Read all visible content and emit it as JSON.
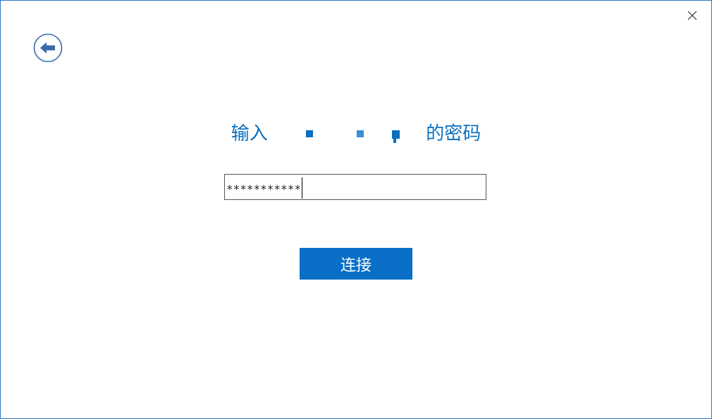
{
  "dialog": {
    "title_prefix": "输入",
    "title_suffix": "的密码",
    "password_value": "***********",
    "connect_label": "连接"
  },
  "icons": {
    "close": "close-icon",
    "back": "back-arrow-icon"
  },
  "colors": {
    "accent": "#0a6fbf",
    "button": "#0a6fc6",
    "border": "#2b78c5"
  }
}
